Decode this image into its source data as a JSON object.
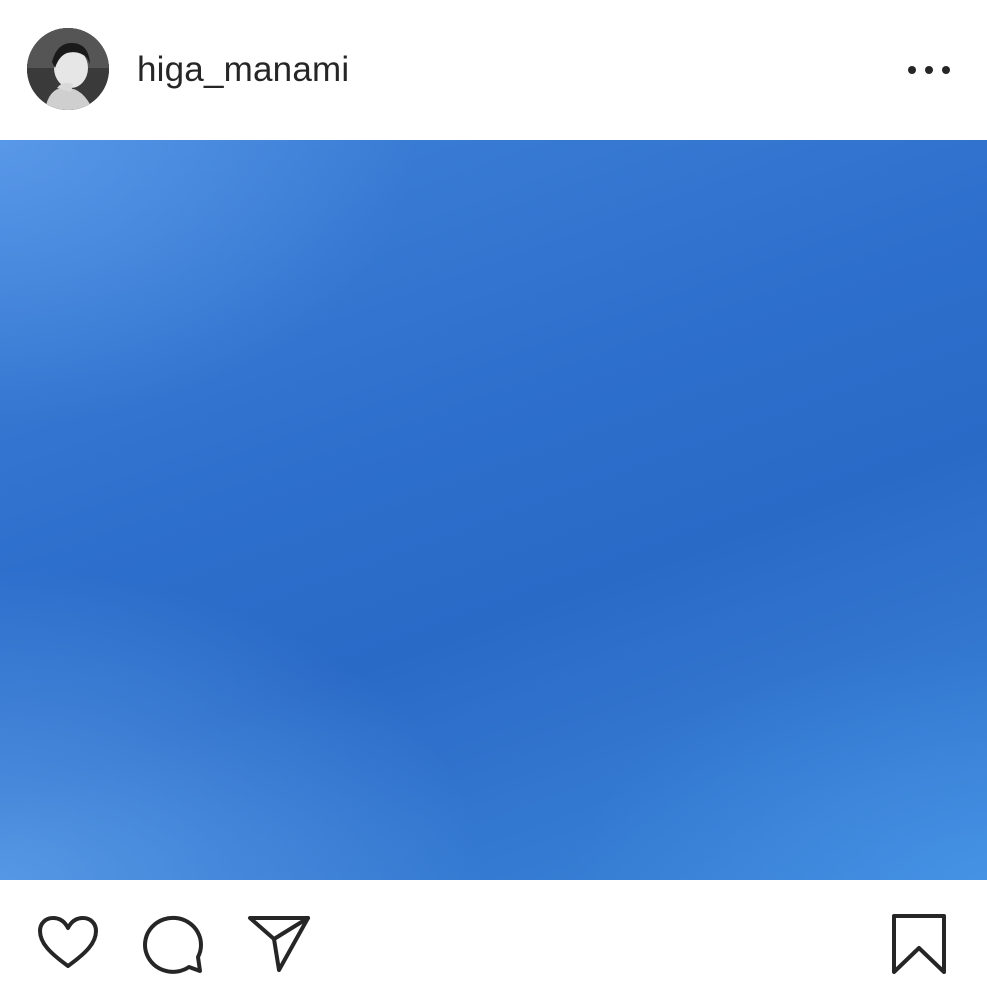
{
  "post": {
    "username": "higa_manami",
    "avatar_icon": "profile-photo-avatar",
    "more_icon": "more-options-icon",
    "image_description_colors": {
      "sky_top_left": "#5b9be5",
      "sky_center": "#2c6ccb",
      "sky_bottom_right": "#4d9ae6"
    }
  },
  "actions": {
    "like_icon": "heart-icon",
    "comment_icon": "comment-icon",
    "share_icon": "paper-plane-icon",
    "save_icon": "bookmark-icon"
  },
  "colors": {
    "text": "#262626",
    "background": "#ffffff",
    "icon_stroke": "#262626"
  }
}
